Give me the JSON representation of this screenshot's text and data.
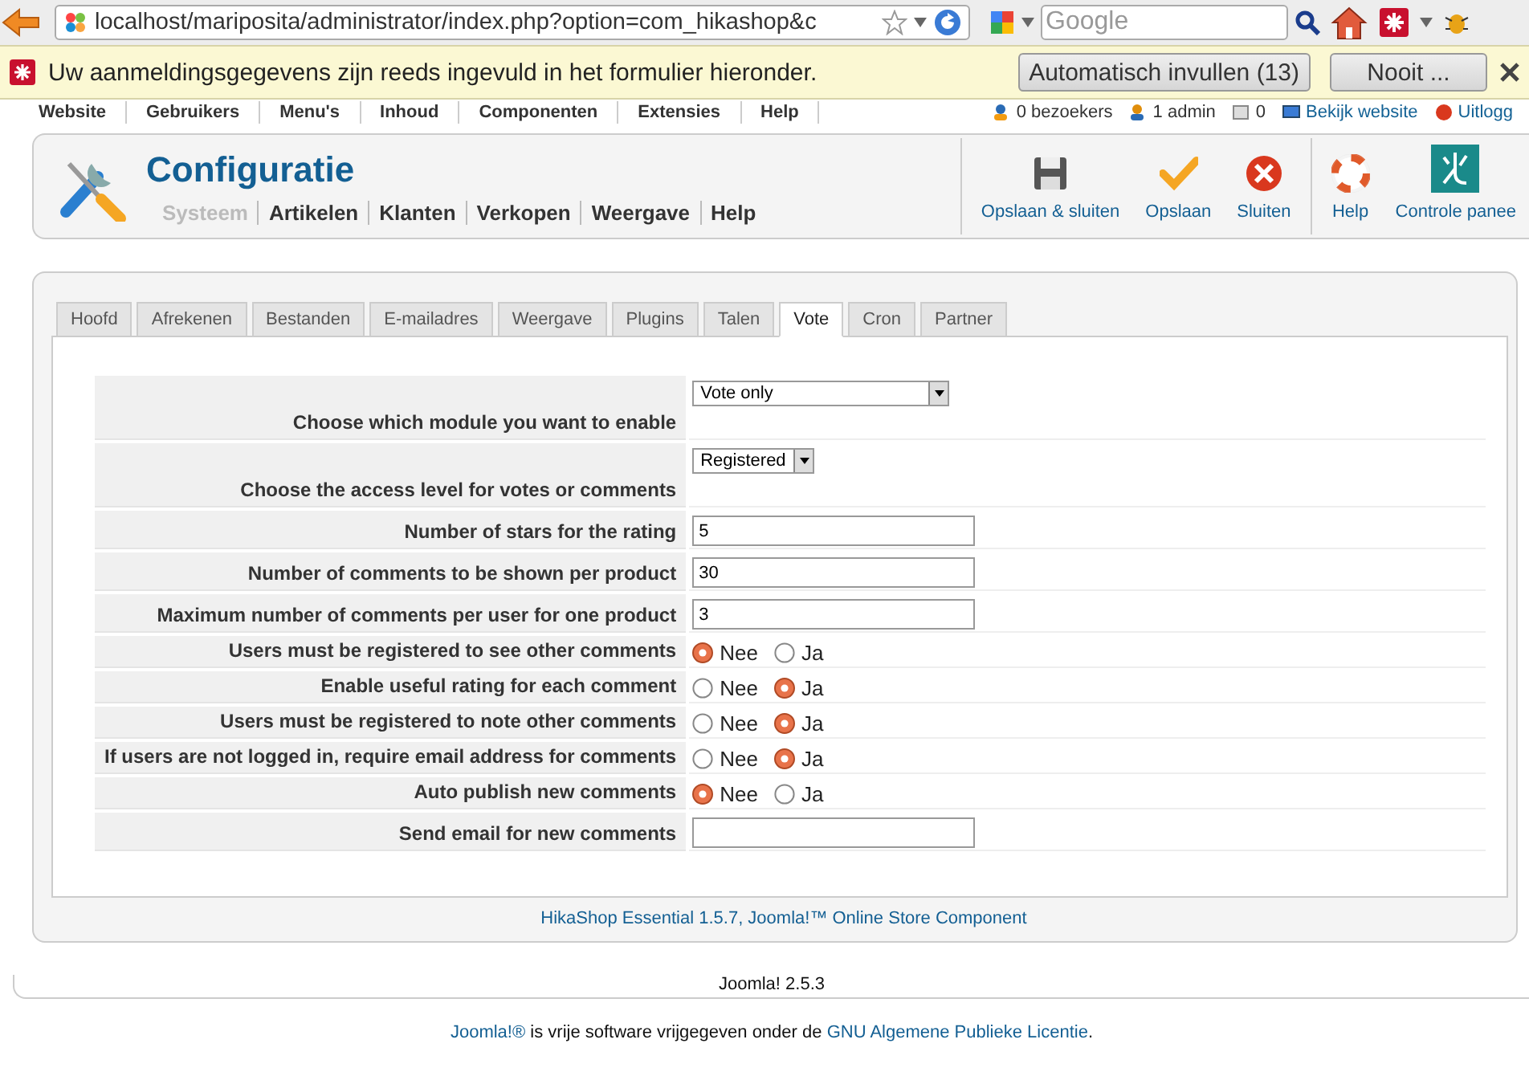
{
  "browser": {
    "url": "localhost/mariposita/administrator/index.php?option=com_hikashop&c",
    "search_placeholder": "Google"
  },
  "notification": {
    "message": "Uw aanmeldingsgegevens zijn reeds ingevuld in het formulier hieronder.",
    "buttons": [
      "Automatisch invullen (13)",
      "Nooit ..."
    ]
  },
  "admin_menu": {
    "items": [
      "Website",
      "Gebruikers",
      "Menu's",
      "Inhoud",
      "Componenten",
      "Extensies",
      "Help"
    ],
    "status": [
      {
        "kind": "visitors",
        "label": "0 bezoekers"
      },
      {
        "kind": "admins",
        "label": "1 admin"
      },
      {
        "kind": "messages",
        "label": "0"
      },
      {
        "kind": "site",
        "label": "Bekijk website"
      },
      {
        "kind": "logout",
        "label": "Uitlogg"
      }
    ]
  },
  "header": {
    "title": "Configuratie",
    "subnav": [
      {
        "label": "Systeem",
        "selected": true
      },
      {
        "label": "Artikelen",
        "selected": false
      },
      {
        "label": "Klanten",
        "selected": false
      },
      {
        "label": "Verkopen",
        "selected": false
      },
      {
        "label": "Weergave",
        "selected": false
      },
      {
        "label": "Help",
        "selected": false
      }
    ],
    "toolbar": [
      {
        "kind": "save-close",
        "label": "Opslaan & sluiten"
      },
      {
        "kind": "save",
        "label": "Opslaan"
      },
      {
        "kind": "close",
        "label": "Sluiten"
      },
      {
        "kind": "help",
        "label": "Help"
      },
      {
        "kind": "panel",
        "label": "Controle panee"
      }
    ]
  },
  "tabs": [
    {
      "label": "Hoofd",
      "selected": false
    },
    {
      "label": "Afrekenen",
      "selected": false
    },
    {
      "label": "Bestanden",
      "selected": false
    },
    {
      "label": "E-mailadres",
      "selected": false
    },
    {
      "label": "Weergave",
      "selected": false
    },
    {
      "label": "Plugins",
      "selected": false
    },
    {
      "label": "Talen",
      "selected": false
    },
    {
      "label": "Vote",
      "selected": true
    },
    {
      "label": "Cron",
      "selected": false
    },
    {
      "label": "Partner",
      "selected": false
    }
  ],
  "settings": [
    {
      "kind": "select",
      "label": "Choose which module you want to enable",
      "value": "Vote only"
    },
    {
      "kind": "select",
      "label": "Choose the access level for votes or comments",
      "value": "Registered"
    },
    {
      "kind": "text",
      "label": "Number of stars for the rating",
      "value": "5"
    },
    {
      "kind": "text",
      "label": "Number of comments to be shown per product",
      "value": "30"
    },
    {
      "kind": "text",
      "label": "Maximum number of comments per user for one product",
      "value": "3"
    },
    {
      "kind": "radio",
      "label": "Users must be registered to see other comments",
      "options": [
        {
          "label": "Nee",
          "selected": true
        },
        {
          "label": "Ja",
          "selected": false
        }
      ]
    },
    {
      "kind": "radio",
      "label": "Enable useful rating for each comment",
      "options": [
        {
          "label": "Nee",
          "selected": false
        },
        {
          "label": "Ja",
          "selected": true
        }
      ]
    },
    {
      "kind": "radio",
      "label": "Users must be registered to note other comments",
      "options": [
        {
          "label": "Nee",
          "selected": false
        },
        {
          "label": "Ja",
          "selected": true
        }
      ]
    },
    {
      "kind": "radio",
      "label": "If users are not logged in, require email address for comments",
      "options": [
        {
          "label": "Nee",
          "selected": false
        },
        {
          "label": "Ja",
          "selected": true
        }
      ]
    },
    {
      "kind": "radio",
      "label": "Auto publish new comments",
      "options": [
        {
          "label": "Nee",
          "selected": true
        },
        {
          "label": "Ja",
          "selected": false
        }
      ]
    },
    {
      "kind": "text",
      "label": "Send email for new comments"
    }
  ],
  "component_credit": "HikaShop Essential 1.5.7, Joomla!™ Online Store Component",
  "footer": {
    "version": "Joomla! 2.5.3",
    "license": [
      {
        "kind": "link",
        "text": "Joomla!®"
      },
      {
        "kind": "text",
        "text": " is vrije software vrijgegeven onder de "
      },
      {
        "kind": "link",
        "text": "GNU Algemene Publieke Licentie"
      },
      {
        "kind": "text",
        "text": "."
      }
    ]
  }
}
